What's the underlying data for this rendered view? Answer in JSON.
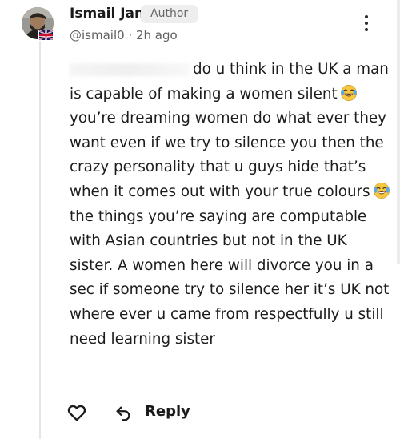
{
  "comment": {
    "author_name": "Ismail Jan",
    "author_badge": "Author",
    "handle": "@ismail0",
    "separator": " · ",
    "timestamp": "2h ago",
    "body_segments": [
      "do u think in the UK a man is capable of making a women silent",
      "you’re dreaming women do what ever they want even if we try to silence you then the crazy personality that u guys hide that’s when it comes out with your true colours",
      "the things you’re saying are computable with Asian countries but not in the UK sister. A women here will divorce you in a sec if someone try to silence her it’s UK not where ever u came from respectfully u still need learning sister"
    ],
    "emoji_icon": "face-with-tears-of-joy-icon",
    "country_flag": "united-kingdom-flag-icon"
  },
  "actions": {
    "like_icon": "heart-outline-icon",
    "reply_icon": "reply-arrow-icon",
    "reply_label": "Reply",
    "menu_icon": "more-vertical-icon"
  },
  "colors": {
    "text": "#1c1c1c",
    "muted": "#606060",
    "badge_bg": "#eeeeee",
    "emoji_face": "#f7c740",
    "emoji_tear": "#5aa9e6"
  }
}
